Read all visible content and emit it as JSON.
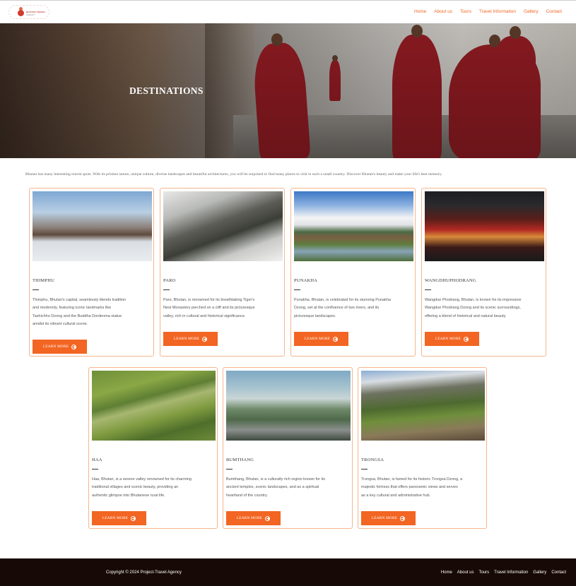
{
  "header": {
    "logo_line1": "BHUTAN TRAVEL",
    "logo_line2": "AGENCY",
    "nav": [
      "Home",
      "About us",
      "Tours",
      "Travel Information",
      "Gallery",
      "Contact"
    ]
  },
  "hero": {
    "title": "DESTINATIONS"
  },
  "intro": "Bhutan has many interesting tourist spots. With its pristine nature, unique culture, diverse landscapes and beautiful architectures, you will be surprised to find many places to visit in such a small country. Discover Bhutan's beauty and make your life's best memory.",
  "button_label": "LEARN MORE",
  "destinations": [
    {
      "name": "THIMPHU",
      "desc": [
        "Thimphu, Bhutan's capital, seamlessly blends tradition",
        "and modernity, featuring iconic landmarks like",
        "Tashichho Dzong and the Buddha Dordenma statue",
        "amidst its vibrant cultural scene."
      ]
    },
    {
      "name": "PARO",
      "desc": [
        "Paro, Bhutan, is renowned for its breathtaking Tiger's",
        "Nest Monastery perched on a cliff and its picturesque",
        "valley, rich in cultural and historical significance."
      ]
    },
    {
      "name": "PUNAKHA",
      "desc": [
        "Punakha, Bhutan, is celebrated for its stunning Punakha",
        "Dzong, set at the confluence of two rivers, and its",
        "picturesque landscapes."
      ]
    },
    {
      "name": "WANGDHUPHODRANG",
      "desc": [
        "Wangdue Phodrang, Bhutan, is known for its impressive",
        "Wangdue Phodrang Dzong and its scenic surroundings,",
        "offering a blend of historical and natural beauty."
      ]
    },
    {
      "name": "HAA",
      "desc": [
        "Haa, Bhutan, is a serene valley renowned for its charming",
        "traditional villages and scenic beauty, providing an",
        "authentic glimpse into Bhutanese rural life."
      ]
    },
    {
      "name": "BUMTHANG",
      "desc": [
        "Bumthang, Bhutan, is a culturally rich region known for its",
        "ancient temples, scenic landscapes, and as a spiritual",
        "heartland of the country."
      ]
    },
    {
      "name": "TRONGSA",
      "desc": [
        "Trongsa, Bhutan, is famed for its historic Trongsa Dzong, a",
        "majestic fortress that offers panoramic views and serves",
        "as a key cultural and administrative hub."
      ]
    }
  ],
  "footer": {
    "copyright": "Copyright © 2024 Project-Travel Agency",
    "nav": [
      "Home",
      "About us",
      "Tours",
      "Travel Information",
      "Gallery",
      "Contact"
    ]
  }
}
